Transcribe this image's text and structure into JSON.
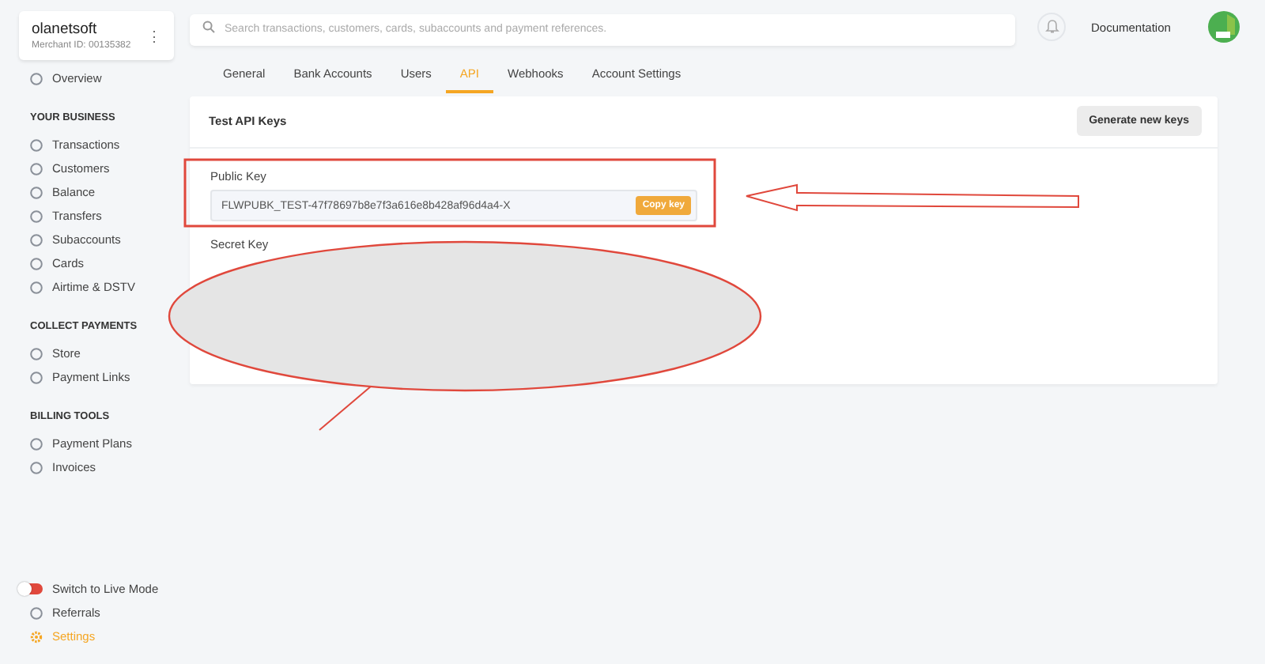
{
  "merchant": {
    "name": "olanetsoft",
    "merchant_id": "Merchant ID: 00135382",
    "menu_icon": "⋮"
  },
  "sidebar": {
    "top_items": [
      {
        "label": "Overview",
        "selected": false
      }
    ],
    "sections": [
      {
        "title": "YOUR BUSINESS",
        "items": [
          {
            "label": "Transactions",
            "selected": false
          },
          {
            "label": "Customers",
            "selected": false
          },
          {
            "label": "Balance",
            "selected": false
          },
          {
            "label": "Transfers",
            "selected": false
          },
          {
            "label": "Subaccounts",
            "selected": false
          },
          {
            "label": "Cards",
            "selected": false
          },
          {
            "label": "Airtime & DSTV",
            "selected": false
          }
        ]
      },
      {
        "title": "COLLECT PAYMENTS",
        "items": [
          {
            "label": "Store",
            "selected": false
          },
          {
            "label": "Payment Links",
            "selected": false
          }
        ]
      },
      {
        "title": "BILLING TOOLS",
        "items": [
          {
            "label": "Payment Plans",
            "selected": false
          },
          {
            "label": "Invoices",
            "selected": false
          }
        ]
      }
    ],
    "live_mode": {
      "label": "Switch to Live Mode",
      "on": false
    },
    "bottom_items": [
      {
        "label": "Referrals",
        "selected": false
      },
      {
        "label": "Settings",
        "selected": true
      }
    ]
  },
  "search": {
    "placeholder": "Search transactions, customers, cards, subaccounts and payment references."
  },
  "header_link": "Documentation",
  "tabs": [
    {
      "label": "General",
      "selected": false
    },
    {
      "label": "Bank Accounts",
      "selected": false
    },
    {
      "label": "Users",
      "selected": false
    },
    {
      "label": "API",
      "selected": true
    },
    {
      "label": "Webhooks",
      "selected": false
    },
    {
      "label": "Account Settings",
      "selected": false
    }
  ],
  "card": {
    "title": "Test API Keys",
    "button": "Generate new keys",
    "keys": [
      {
        "label": "Public Key",
        "value": "FLWPUBK_TEST-47f78697b8e7f3a616e8b428af96d4a4-X",
        "copy": "Copy key"
      },
      {
        "label": "Secret Key"
      }
    ]
  }
}
